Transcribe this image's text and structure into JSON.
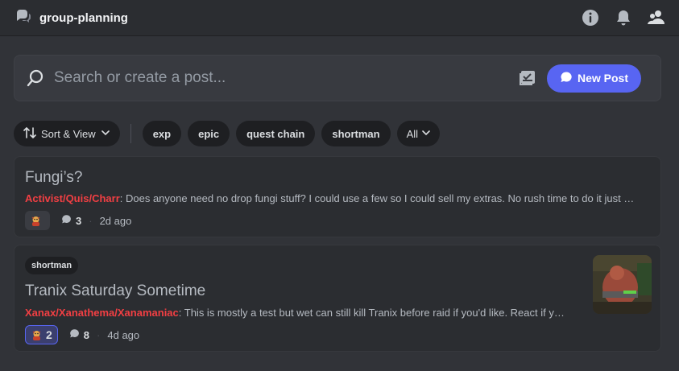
{
  "header": {
    "channel_name": "group-planning",
    "icons": [
      "forum-icon",
      "info-icon",
      "bell-icon",
      "members-icon"
    ]
  },
  "search": {
    "placeholder": "Search or create a post...",
    "new_post_label": "New Post"
  },
  "filters": {
    "sort_label": "Sort & View",
    "tags": [
      "exp",
      "epic",
      "quest chain",
      "shortman"
    ],
    "all_label": "All"
  },
  "posts": [
    {
      "title": "Fungi’s?",
      "author": "Activist/Quis/Charr",
      "snippet": ": Does anyone need no drop fungi stuff? I could use a few so I could sell my extras. No rush time to do it just …",
      "reaction_count": "",
      "message_count": "3",
      "time": "2d ago"
    },
    {
      "tag": "shortman",
      "title": "Tranix Saturday Sometime",
      "author": "Xanax/Xanathema/Xanamaniac",
      "snippet": ": This is mostly a test but wet can still kill Tranix before raid if you'd like. React if y…",
      "reaction_count": "2",
      "message_count": "8",
      "time": "4d ago"
    }
  ],
  "separator": "·",
  "colors": {
    "accent": "#5865f2",
    "author": "#f23f43",
    "background": "#313338",
    "card": "#2b2d31"
  }
}
